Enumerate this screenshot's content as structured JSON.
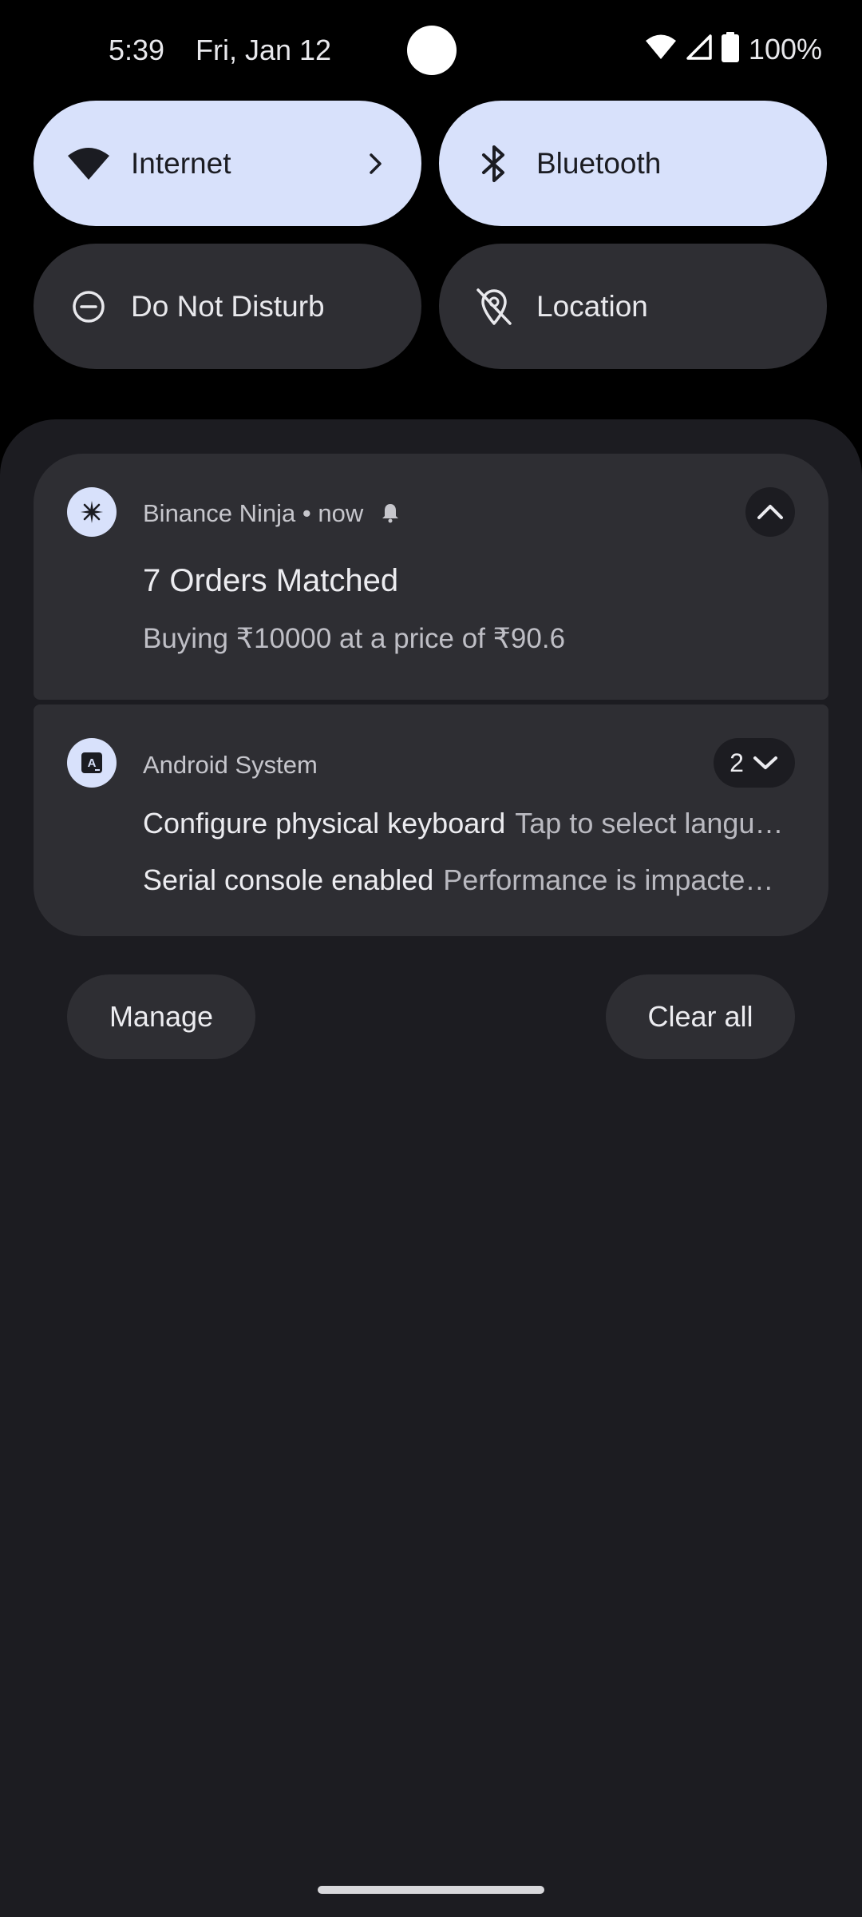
{
  "status_bar": {
    "time": "5:39",
    "date": "Fri, Jan 12",
    "battery": "100%"
  },
  "quick_settings": {
    "tiles": [
      {
        "label": "Internet",
        "icon": "wifi-icon",
        "state": "on",
        "has_chevron": true
      },
      {
        "label": "Bluetooth",
        "icon": "bluetooth-icon",
        "state": "on"
      },
      {
        "label": "Do Not Disturb",
        "icon": "do-not-disturb-icon",
        "state": "off"
      },
      {
        "label": "Location",
        "icon": "location-off-icon",
        "state": "off"
      }
    ]
  },
  "notifications": [
    {
      "app": "Binance Ninja • now",
      "app_icon": "sparkle-icon",
      "title": "7 Orders Matched",
      "text": "Buying ₹10000 at a price of ₹90.6",
      "expanded": true
    },
    {
      "app": "Android System",
      "app_icon": "keyboard-language-icon",
      "count": "2",
      "lines": [
        {
          "title": "Configure physical keyboard",
          "text": "Tap to select langu…"
        },
        {
          "title": "Serial console enabled",
          "text": "Performance is impacte…"
        }
      ]
    }
  ],
  "actions": {
    "manage": "Manage",
    "clear_all": "Clear all"
  },
  "colors": {
    "tile_on": "#d8e1fb",
    "tile_off": "#2e2e33",
    "shade": "#1c1c21",
    "card": "#2e2e33"
  }
}
